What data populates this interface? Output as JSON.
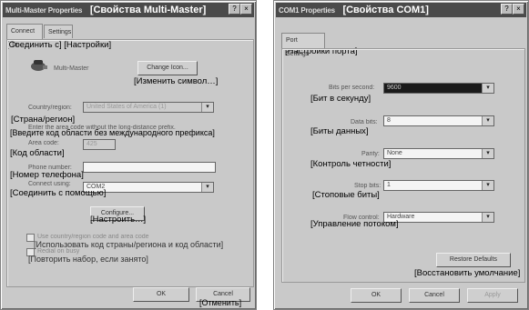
{
  "left_dialog": {
    "title_en": "Multi-Master Properties",
    "title_ru": "[Свойства Multi-Master]",
    "tabs": [
      "Connect To",
      "Settings"
    ],
    "tabs_annotation": "[Соединить с] [Настройки]",
    "modem_name": "Multi-Master",
    "change_icon_label": "Change Icon...",
    "change_icon_annotation": "[Изменить символ…]",
    "country_label": "Country/region:",
    "country_value": "United States of America (1)",
    "country_annotation": "[Страна/регион]",
    "area_hint": "Enter the area code without the long-distance prefix.",
    "area_hint_annotation": "[Введите код области без международного префикса]",
    "area_code_label": "Area code:",
    "area_code_value": "425",
    "area_code_annotation": "[Код области]",
    "phone_label": "Phone number:",
    "phone_annotation": "[Номер телефона]",
    "connect_using_label": "Connect using:",
    "connect_using_value": "COM2",
    "connect_using_annotation": "[Соединить с помощью]",
    "configure_label": "Configure...",
    "configure_annotation": "[Настроить…]",
    "use_country_label": "Use country/region code and area code",
    "use_country_annotation": "[Использовать код страны/региона и код области]",
    "redial_label": "Redial on busy",
    "redial_annotation": "[Повторить набор, если занято]",
    "ok_label": "OK",
    "cancel_label": "Cancel",
    "cancel_annotation": "[Отменить]"
  },
  "right_dialog": {
    "title_en": "COM1 Properties",
    "title_ru": "[Свойства COM1]",
    "tab": "Port Settings",
    "tab_annotation": "[Настройки порта]",
    "fields": [
      {
        "label": "Bits per second:",
        "value": "9600",
        "annotation": "[Бит в секунду]"
      },
      {
        "label": "Data bits:",
        "value": "8",
        "annotation": "[Биты данных]"
      },
      {
        "label": "Parity:",
        "value": "None",
        "annotation": "[Контроль четности]"
      },
      {
        "label": "Stop bits:",
        "value": "1",
        "annotation": "[Стоповые биты]"
      },
      {
        "label": "Flow control:",
        "value": "Hardware",
        "annotation": "[Управление потоком]"
      }
    ],
    "restore_label": "Restore Defaults",
    "restore_annotation": "[Восстановить умолчание]",
    "ok_label": "OK",
    "cancel_label": "Cancel",
    "apply_label": "Apply"
  }
}
